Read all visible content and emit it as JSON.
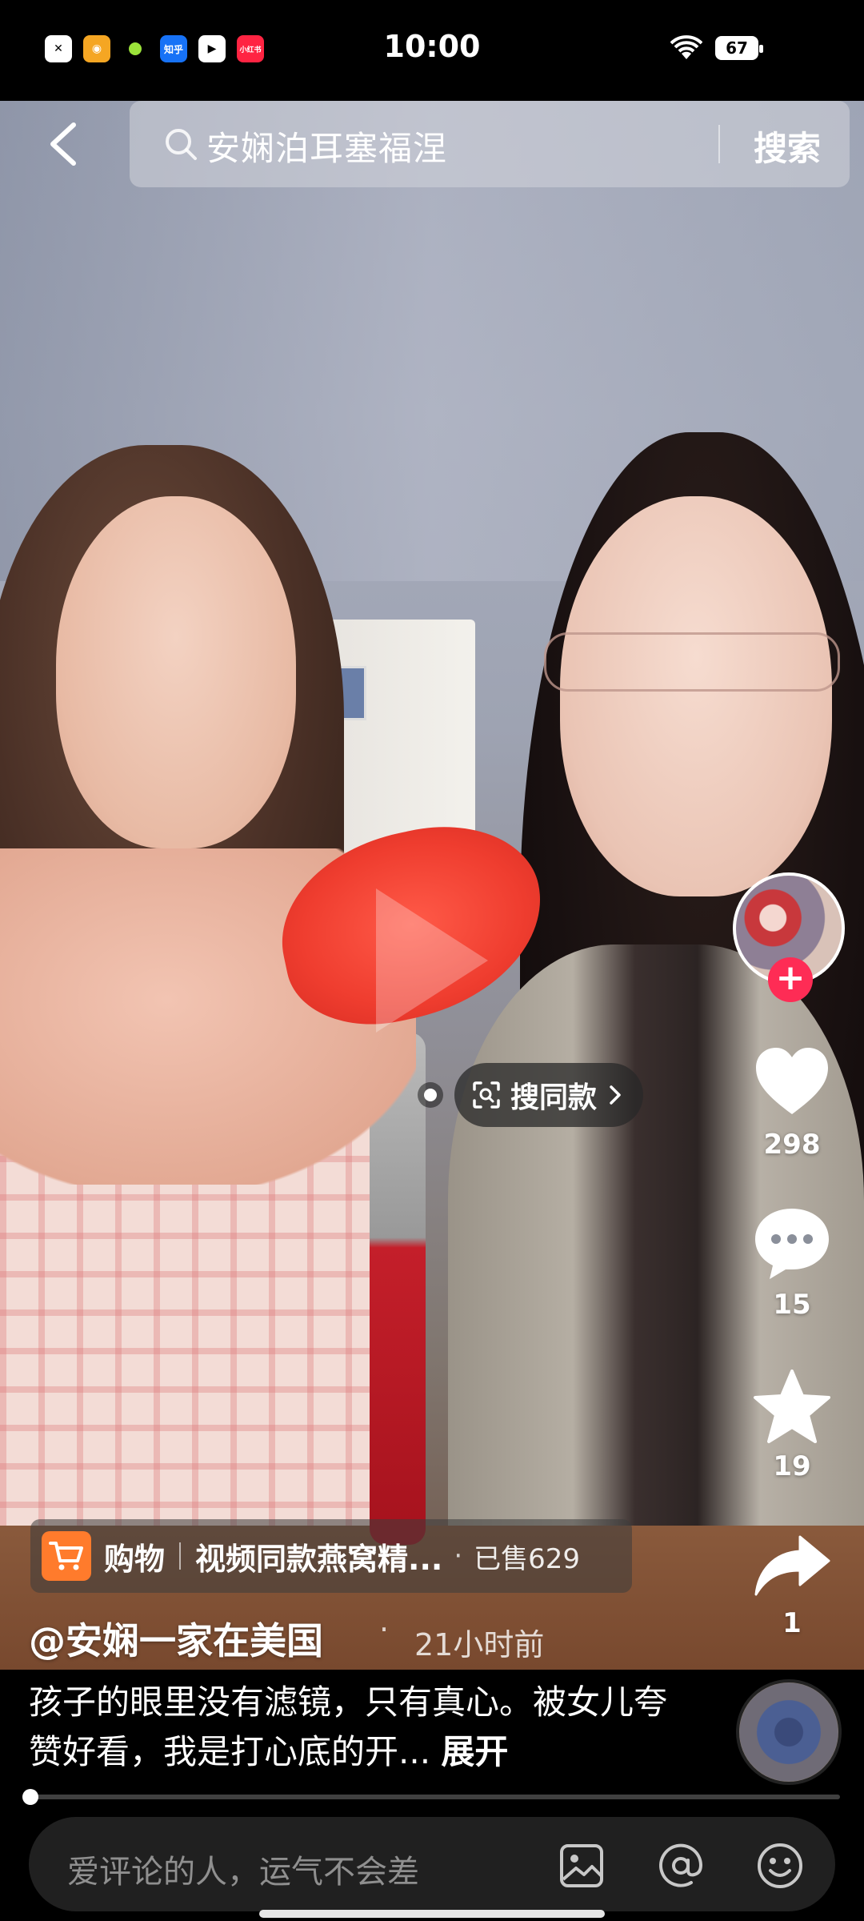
{
  "status_bar": {
    "time": "10:00",
    "battery": "67",
    "apps": [
      "x-app-icon",
      "meituan-icon",
      "wechat-dot-icon",
      "zhihu-icon",
      "video-icon",
      "xiaohongshu-icon"
    ],
    "app_labels": {
      "zhihu": "知乎",
      "xhs": "小红书"
    }
  },
  "search": {
    "query": "安娴泊耳塞福涅",
    "button_label": "搜索"
  },
  "overlay": {
    "find_same_label": "搜同款"
  },
  "rail": {
    "likes": "298",
    "comments": "15",
    "favorites": "19",
    "shares": "1"
  },
  "shop": {
    "label": "购物",
    "title": "视频同款燕窝精...",
    "sold": "已售629"
  },
  "post": {
    "author": "@安娴一家在美国",
    "time_ago": "21小时前",
    "caption": "孩子的眼里没有滤镜，只有真心。被女儿夸赞好看，我是打心底的开...",
    "expand_label": "展开"
  },
  "progress": {
    "fraction": 0.01
  },
  "comment": {
    "placeholder": "爱评论的人，运气不会差"
  },
  "colors": {
    "accent": "#fe2c55",
    "cart": "#ff7b2c"
  }
}
